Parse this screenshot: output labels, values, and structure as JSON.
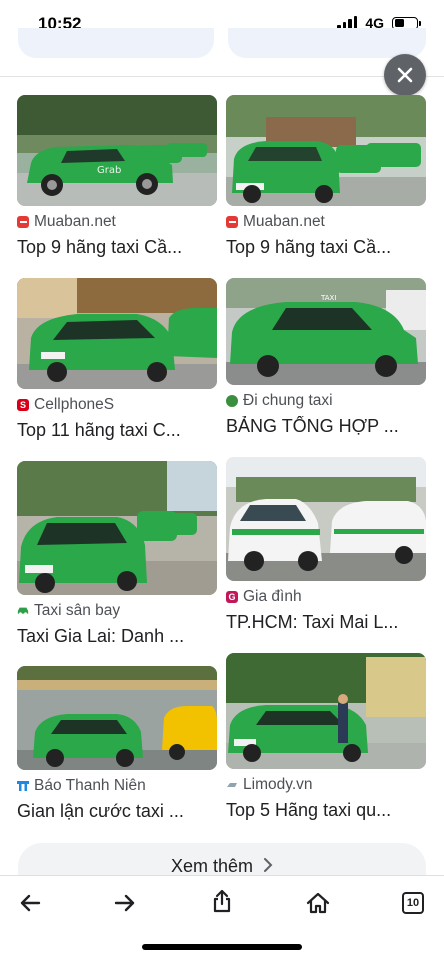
{
  "status": {
    "time": "10:52",
    "network": "4G",
    "battery_level": 0.45
  },
  "results": [
    {
      "source": "Muaban.net",
      "title": "Top 9 hãng taxi Cầ...",
      "source_icon": "muaban-icon",
      "icon_color": "#e53935"
    },
    {
      "source": "Muaban.net",
      "title": "Top 9 hãng taxi Cầ...",
      "source_icon": "muaban-icon",
      "icon_color": "#e53935"
    },
    {
      "source": "CellphoneS",
      "title": "Top 11 hãng taxi C...",
      "source_icon": "cellphones-icon",
      "icon_color": "#d70018"
    },
    {
      "source": "Đi chung taxi",
      "title": "BẢNG TỔNG HỢP ...",
      "source_icon": "dichung-icon",
      "icon_color": "#3a8f3e"
    },
    {
      "source": "Taxi sân bay",
      "title": "Taxi Gia Lai: Danh ...",
      "source_icon": "taxi-car-icon",
      "icon_color": "#2e9e48"
    },
    {
      "source": "Gia đình",
      "title": "TP.HCM: Taxi Mai L...",
      "source_icon": "giadinh-icon",
      "icon_color": "#c2185b"
    },
    {
      "source": "Báo Thanh Niên",
      "title": "Gian lận cước taxi ...",
      "source_icon": "thanhnien-icon",
      "icon_color": "#1e88e5"
    },
    {
      "source": "Limody.vn",
      "title": "Top 5 Hãng taxi qu...",
      "source_icon": "limody-icon",
      "icon_color": "#90a4ae"
    }
  ],
  "more_button": {
    "label": "Xem thêm"
  },
  "bottom_nav": {
    "tabs_count": "10"
  },
  "colors": {
    "taxi_green": "#2aa84a",
    "taxi_white": "#f4f4f4",
    "taxi_yellow": "#f2c200",
    "close_button": "#5f6368"
  }
}
